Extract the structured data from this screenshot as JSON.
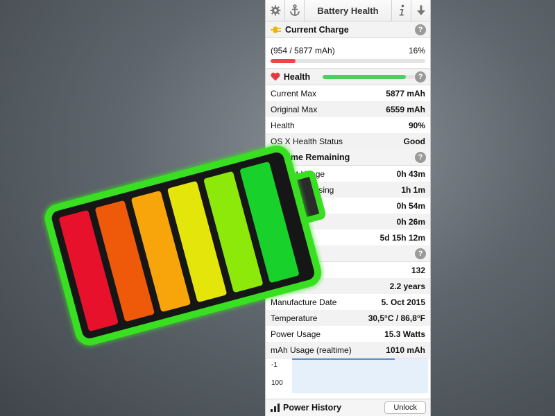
{
  "toolbar": {
    "title": "Battery Health",
    "icons": [
      "gear-icon",
      "anchor-icon",
      "info-icon",
      "download-icon"
    ]
  },
  "current_charge": {
    "title": "Current Charge",
    "mah_text": "(954 / 5877 mAh)",
    "percent_text": "16%",
    "fraction": 0.16,
    "bar_color": "#f0444c",
    "icon": "plug-icon"
  },
  "health": {
    "title": "Health",
    "fraction": 0.9,
    "bar_color": "#48d162",
    "icon": "heart-icon",
    "rows": [
      {
        "label": "Current Max",
        "value": "5877 mAh"
      },
      {
        "label": "Original Max",
        "value": "6559 mAh"
      },
      {
        "label": "Health",
        "value": "90%"
      },
      {
        "label": "OS X Health Status",
        "value": "Good"
      }
    ]
  },
  "time_remaining": {
    "title": "Time Remaining",
    "icon": "clock-icon",
    "rows": [
      {
        "label": "Current Usage",
        "value": "0h 43m"
      },
      {
        "label": "Browsing",
        "value": "1h 1m"
      },
      {
        "label": "",
        "value": "0h 54m"
      },
      {
        "label": "",
        "value": "0h 26m"
      },
      {
        "label": "by",
        "value": "5d 15h 12m"
      }
    ]
  },
  "details": {
    "title": "ils",
    "rows": [
      {
        "label": "es",
        "value": "132"
      },
      {
        "label": "Age",
        "value": "2.2 years"
      },
      {
        "label": "Manufacture Date",
        "value": "5. Oct 2015"
      },
      {
        "label": "Temperature",
        "value": "30,5°C / 86,8°F"
      },
      {
        "label": "Power Usage",
        "value": "15.3 Watts"
      },
      {
        "label": "mAh Usage (realtime)",
        "value": "1010 mAh"
      }
    ]
  },
  "graph": {
    "label_top": "-1",
    "label_bottom": "100"
  },
  "power_history": {
    "title": "Power History",
    "icon": "bar-chart-icon",
    "unlock_label": "Unlock"
  },
  "colors": {
    "battery_outline": "#39e021",
    "cells": [
      "#e8112c",
      "#ef5a0a",
      "#f7a50a",
      "#e3e50b",
      "#8ce90a",
      "#18d12b"
    ]
  }
}
